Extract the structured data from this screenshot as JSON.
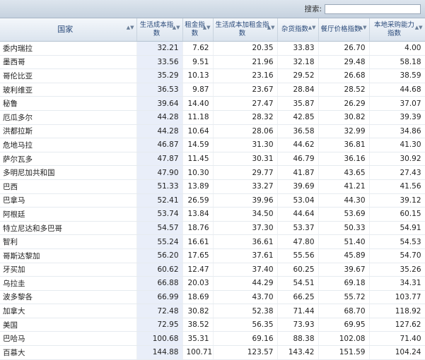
{
  "search": {
    "label": "搜索:",
    "value": ""
  },
  "columns": [
    "国家",
    "生活成本指数",
    "租金指数",
    "生活成本加租金指数",
    "杂货指数",
    "餐厅价格指数",
    "本地采购能力指数"
  ],
  "rows": [
    [
      "委内瑞拉",
      "32.21",
      "7.62",
      "20.35",
      "33.83",
      "26.70",
      "4.00"
    ],
    [
      "墨西哥",
      "33.56",
      "9.51",
      "21.96",
      "32.18",
      "29.48",
      "58.18"
    ],
    [
      "哥伦比亚",
      "35.29",
      "10.13",
      "23.16",
      "29.52",
      "26.68",
      "38.59"
    ],
    [
      "玻利维亚",
      "36.53",
      "9.87",
      "23.67",
      "28.84",
      "28.52",
      "44.68"
    ],
    [
      "秘鲁",
      "39.64",
      "14.40",
      "27.47",
      "35.87",
      "26.29",
      "37.07"
    ],
    [
      "厄瓜多尔",
      "44.28",
      "11.18",
      "28.32",
      "42.85",
      "30.82",
      "39.39"
    ],
    [
      "洪都拉斯",
      "44.28",
      "10.64",
      "28.06",
      "36.58",
      "32.99",
      "34.86"
    ],
    [
      "危地马拉",
      "46.87",
      "14.59",
      "31.30",
      "44.62",
      "36.81",
      "41.30"
    ],
    [
      "萨尔瓦多",
      "47.87",
      "11.45",
      "30.31",
      "46.79",
      "36.16",
      "30.92"
    ],
    [
      "多明尼加共和国",
      "47.90",
      "10.30",
      "29.77",
      "41.87",
      "43.65",
      "27.43"
    ],
    [
      "巴西",
      "51.33",
      "13.89",
      "33.27",
      "39.69",
      "41.21",
      "41.56"
    ],
    [
      "巴拿马",
      "52.41",
      "26.59",
      "39.96",
      "53.04",
      "44.30",
      "39.12"
    ],
    [
      "阿根廷",
      "53.74",
      "13.84",
      "34.50",
      "44.64",
      "53.69",
      "60.15"
    ],
    [
      "特立尼达和多巴哥",
      "54.57",
      "18.76",
      "37.30",
      "53.37",
      "50.33",
      "54.91"
    ],
    [
      "智利",
      "55.24",
      "16.61",
      "36.61",
      "47.80",
      "51.40",
      "54.53"
    ],
    [
      "哥斯达黎加",
      "56.20",
      "17.65",
      "37.61",
      "55.56",
      "45.89",
      "54.70"
    ],
    [
      "牙买加",
      "60.62",
      "12.47",
      "37.40",
      "60.25",
      "39.67",
      "35.26"
    ],
    [
      "乌拉圭",
      "66.88",
      "20.03",
      "44.29",
      "54.51",
      "69.18",
      "34.31"
    ],
    [
      "波多黎各",
      "66.99",
      "18.69",
      "43.70",
      "66.25",
      "55.72",
      "103.77"
    ],
    [
      "加拿大",
      "72.48",
      "30.82",
      "52.38",
      "71.44",
      "68.70",
      "118.92"
    ],
    [
      "美国",
      "72.95",
      "38.52",
      "56.35",
      "73.93",
      "69.95",
      "127.62"
    ],
    [
      "巴哈马",
      "100.68",
      "35.31",
      "69.16",
      "88.38",
      "102.08",
      "71.40"
    ],
    [
      "百慕大",
      "144.88",
      "100.71",
      "123.57",
      "143.42",
      "151.59",
      "104.24"
    ]
  ]
}
